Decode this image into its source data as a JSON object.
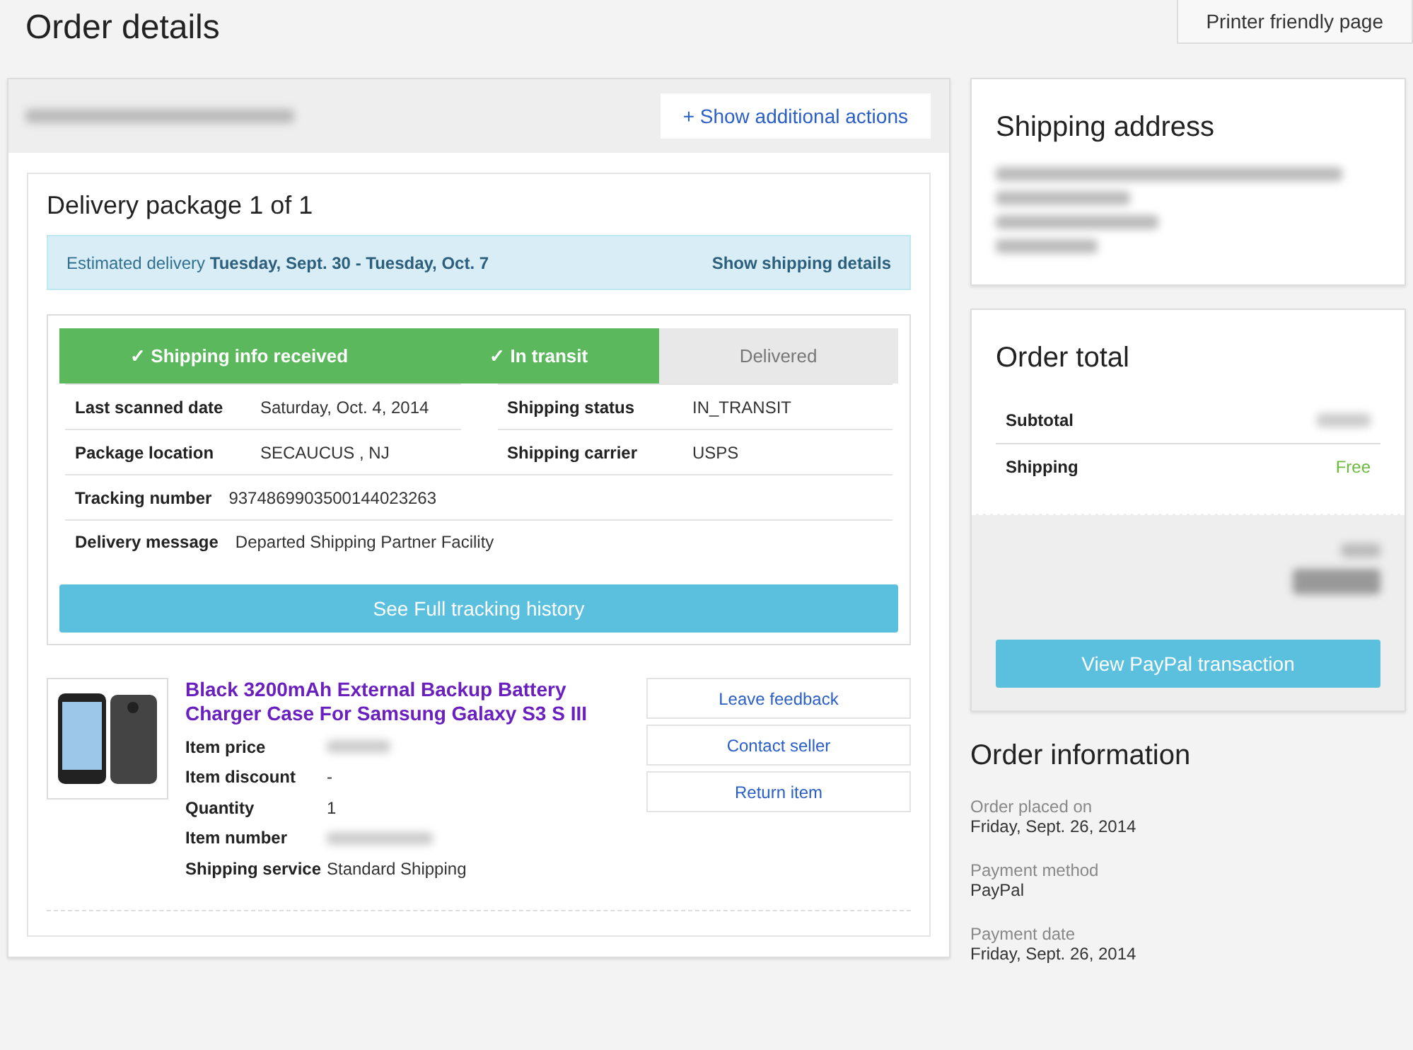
{
  "page": {
    "title": "Order details",
    "print_button": "Printer friendly page"
  },
  "order_panel": {
    "actions_button": "+ Show additional actions",
    "package": {
      "title": "Delivery package 1 of 1",
      "estimate_label": "Estimated delivery",
      "estimate_dates": "Tuesday, Sept. 30 - Tuesday, Oct. 7",
      "details_link": "Show shipping details",
      "steps": [
        {
          "label": "✓ Shipping info received",
          "done": true
        },
        {
          "label": "✓ In transit",
          "done": true
        },
        {
          "label": "Delivered",
          "done": false
        }
      ],
      "detail_rows": [
        [
          {
            "label": "Last scanned date",
            "value": "Saturday, Oct. 4, 2014"
          },
          {
            "label": "Shipping status",
            "value": "IN_TRANSIT"
          }
        ],
        [
          {
            "label": "Package location",
            "value": "SECAUCUS , NJ"
          },
          {
            "label": "Shipping carrier",
            "value": "USPS"
          }
        ],
        [
          {
            "label": "Tracking number",
            "value": "9374869903500144023263"
          }
        ],
        [
          {
            "label": "Delivery message",
            "value": "Departed Shipping Partner Facility"
          }
        ]
      ],
      "history_button": "See Full tracking history"
    },
    "item": {
      "title": "Black 3200mAh External Backup Battery Charger Case For Samsung Galaxy S3 S III",
      "fields": [
        {
          "label": "Item price",
          "redacted": true
        },
        {
          "label": "Item discount",
          "value": "-",
          "redacted": false
        },
        {
          "label": "Quantity",
          "value": "1",
          "redacted": false
        },
        {
          "label": "Item number",
          "redacted": true
        },
        {
          "label": "Shipping service",
          "value": "Standard Shipping",
          "redacted": false
        }
      ],
      "actions": [
        "Leave feedback",
        "Contact seller",
        "Return item"
      ]
    }
  },
  "shipping_address": {
    "title": "Shipping address"
  },
  "order_total": {
    "title": "Order total",
    "lines": [
      {
        "label": "Subtotal",
        "redacted": true
      },
      {
        "label": "Shipping",
        "value": "Free",
        "redacted": false
      }
    ],
    "paypal_button": "View PayPal transaction"
  },
  "order_information": {
    "title": "Order information",
    "entries": [
      {
        "label": "Order placed on",
        "value": "Friday, Sept. 26, 2014"
      },
      {
        "label": "Payment method",
        "value": "PayPal"
      },
      {
        "label": "Payment date",
        "value": "Friday, Sept. 26, 2014"
      }
    ]
  }
}
